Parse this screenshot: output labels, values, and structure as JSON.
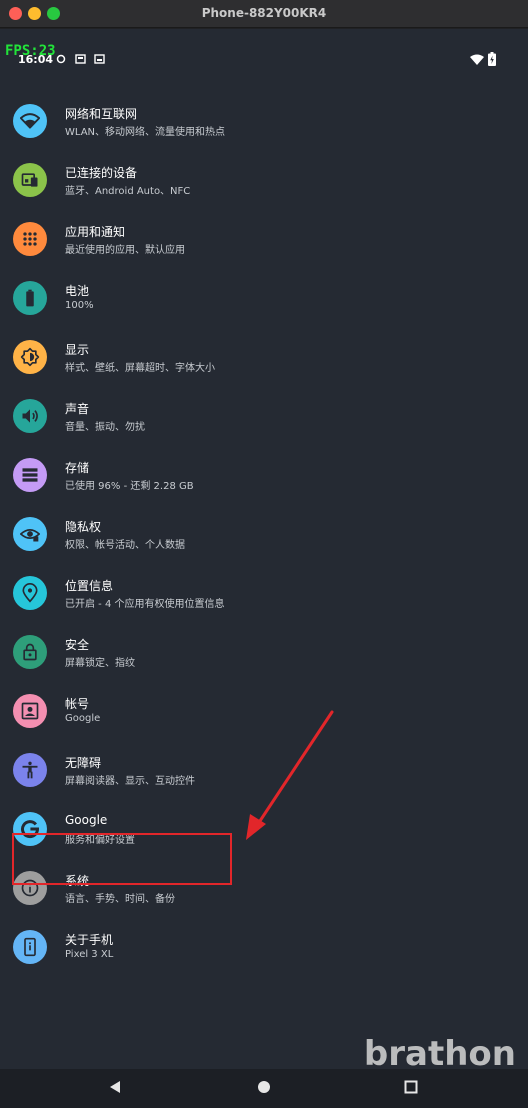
{
  "window": {
    "title": "Phone-882Y00KR4"
  },
  "status_bar": {
    "fps": "FPS:23",
    "time": "16:04"
  },
  "colors": {
    "background": "#252a33",
    "highlight": "#e2262a",
    "wifi": "#4fc3f7",
    "devices": "#8bc34a",
    "apps": "#ff8a3d",
    "battery": "#26a69a",
    "display": "#ffb347",
    "sound": "#26a69a",
    "storage": "#c49bf5",
    "privacy": "#4fc3f7",
    "location": "#26c6da",
    "security": "#2e9e7a",
    "accounts": "#f48fb1",
    "accessibility": "#7b83eb",
    "google": "#4fc3f7",
    "system": "#9e9e9e",
    "about": "#64b5f6"
  },
  "settings": [
    {
      "icon": "wifi-icon",
      "title": "网络和互联网",
      "subtitle": "WLAN、移动网络、流量使用和热点"
    },
    {
      "icon": "connected-devices-icon",
      "title": "已连接的设备",
      "subtitle": "蓝牙、Android Auto、NFC"
    },
    {
      "icon": "apps-icon",
      "title": "应用和通知",
      "subtitle": "最近使用的应用、默认应用"
    },
    {
      "icon": "battery-icon",
      "title": "电池",
      "subtitle": "100%"
    },
    {
      "icon": "display-icon",
      "title": "显示",
      "subtitle": "样式、壁纸、屏幕超时、字体大小"
    },
    {
      "icon": "sound-icon",
      "title": "声音",
      "subtitle": "音量、振动、勿扰"
    },
    {
      "icon": "storage-icon",
      "title": "存储",
      "subtitle": "已使用 96% - 还剩 2.28 GB"
    },
    {
      "icon": "privacy-icon",
      "title": "隐私权",
      "subtitle": "权限、帐号活动、个人数据"
    },
    {
      "icon": "location-icon",
      "title": "位置信息",
      "subtitle": "已开启 - 4 个应用有权使用位置信息"
    },
    {
      "icon": "lock-icon",
      "title": "安全",
      "subtitle": "屏幕锁定、指纹"
    },
    {
      "icon": "account-icon",
      "title": "帐号",
      "subtitle": "Google"
    },
    {
      "icon": "accessibility-icon",
      "title": "无障碍",
      "subtitle": "屏幕阅读器、显示、互动控件"
    },
    {
      "icon": "google-icon",
      "title": "Google",
      "subtitle": "服务和偏好设置"
    },
    {
      "icon": "info-icon",
      "title": "系统",
      "subtitle": "语言、手势、时间、备份"
    },
    {
      "icon": "phone-icon",
      "title": "关于手机",
      "subtitle": "Pixel 3 XL"
    }
  ],
  "watermark": "brathon"
}
